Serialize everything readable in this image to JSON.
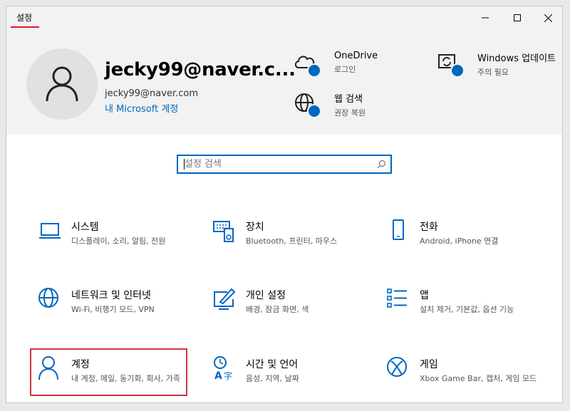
{
  "window": {
    "title": "설정"
  },
  "account": {
    "name": "jecky99@naver.c...",
    "email": "jecky99@naver.com",
    "link": "내 Microsoft 계정"
  },
  "header_items": [
    {
      "title": "OneDrive",
      "subtitle": "로그인",
      "icon": "cloud-icon"
    },
    {
      "title": "웹 검색",
      "subtitle": "권장 복원",
      "icon": "globe-icon"
    },
    {
      "title": "Windows 업데이트",
      "subtitle": "주의 필요",
      "icon": "sync-icon"
    }
  ],
  "search": {
    "placeholder": "설정 검색"
  },
  "tiles": [
    {
      "name": "시스템",
      "desc": "디스플레이, 소리, 알림, 전원",
      "icon": "laptop-icon"
    },
    {
      "name": "장치",
      "desc": "Bluetooth, 프린터, 마우스",
      "icon": "keyboard-speaker-icon"
    },
    {
      "name": "전화",
      "desc": "Android, iPhone 연결",
      "icon": "phone-icon"
    },
    {
      "name": "네트워크 및 인터넷",
      "desc": "Wi-Fi, 비행기 모드, VPN",
      "icon": "globe-icon"
    },
    {
      "name": "개인 설정",
      "desc": "배경, 잠금 화면, 색",
      "icon": "pen-tablet-icon"
    },
    {
      "name": "앱",
      "desc": "설치 제거, 기본값, 옵션 기능",
      "icon": "apps-list-icon"
    },
    {
      "name": "계정",
      "desc": "내 계정, 메일, 동기화, 회사, 가족",
      "icon": "person-icon"
    },
    {
      "name": "시간 및 언어",
      "desc": "음성, 지역, 날짜",
      "icon": "time-language-icon"
    },
    {
      "name": "게임",
      "desc": "Xbox Game Bar, 캡처, 게임 모드",
      "icon": "xbox-icon"
    }
  ],
  "colors": {
    "accent": "#0067c0",
    "highlight": "#d13438",
    "header_bg": "#f2f2f2"
  }
}
